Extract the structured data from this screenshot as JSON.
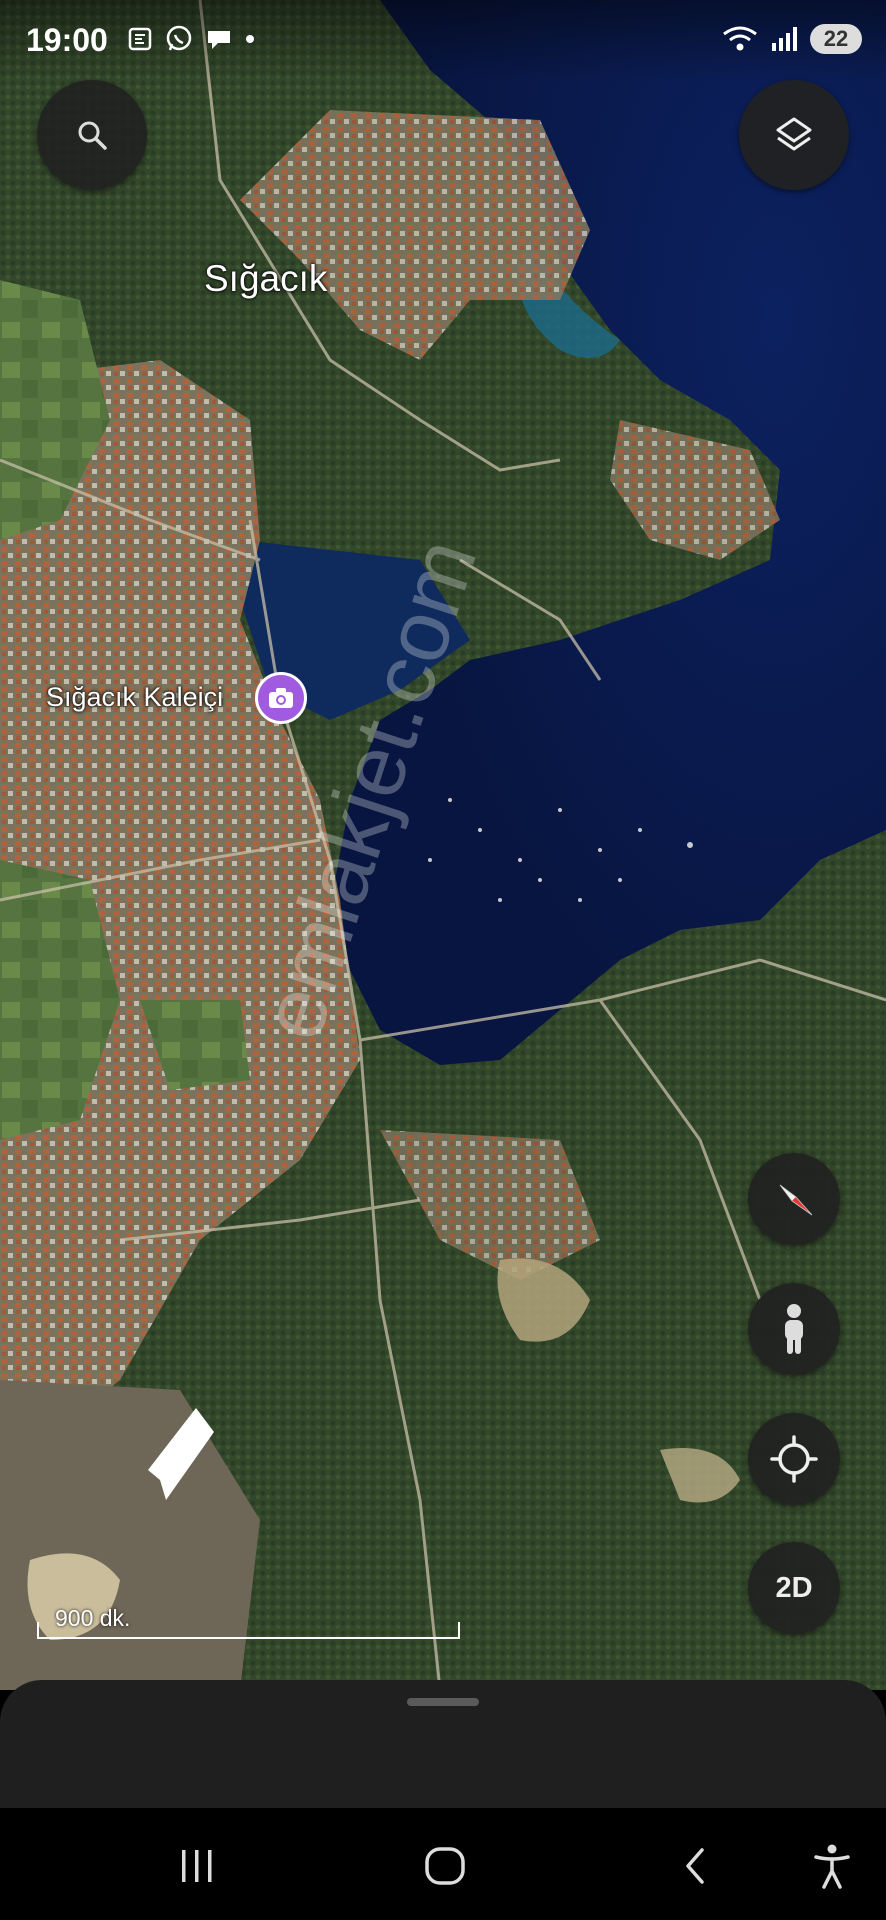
{
  "status_bar": {
    "time": "19:00",
    "battery": "22",
    "left_icons": [
      "screenshot-icon",
      "whatsapp-icon",
      "chat-icon",
      "dot-icon"
    ],
    "right_icons": [
      "wifi-icon",
      "signal-icon",
      "battery-icon"
    ]
  },
  "map": {
    "type": "satellite",
    "labels": {
      "town": "Sığacık",
      "poi": "Sığacık Kaleiçi"
    },
    "poi_icon": "camera-icon",
    "scale_label": "900 dk.",
    "watermark": "emlakjet.com",
    "colors": {
      "sea_deep": "#0b1e52",
      "sea_mid": "#143a78",
      "land_green": "#3c5a32",
      "urban": "#8a7560",
      "poi_purple": "#a05be0"
    }
  },
  "controls": {
    "search_icon": "search-icon",
    "layers_icon": "layers-icon",
    "compass_icon": "compass-icon",
    "streetview_icon": "pegman-icon",
    "locate_icon": "locate-icon",
    "view_mode": "2D"
  },
  "nav_bar": {
    "buttons": [
      "recent-apps-icon",
      "home-icon",
      "back-icon",
      "accessibility-icon"
    ]
  }
}
